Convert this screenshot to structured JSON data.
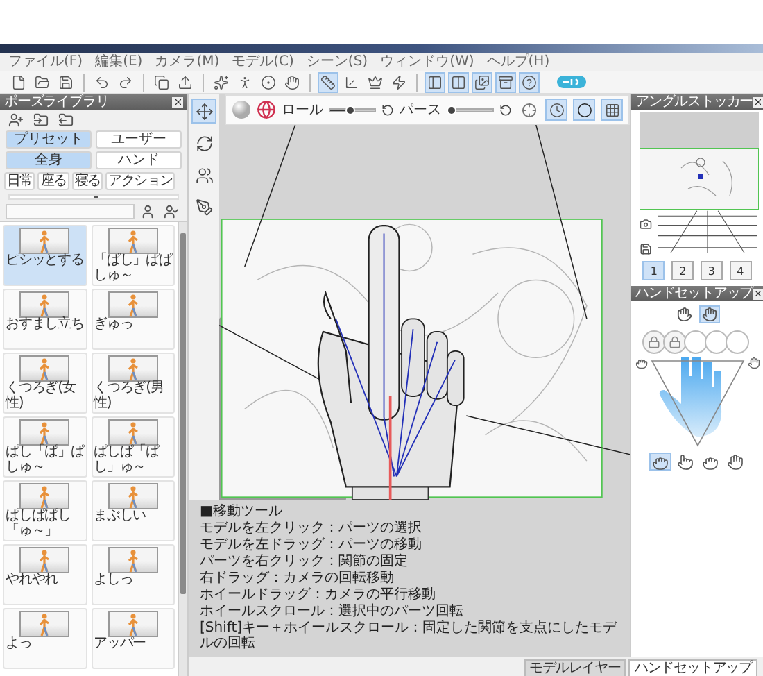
{
  "menu": [
    "ファイル(F)",
    "編集(E)",
    "カメラ(M)",
    "モデル(C)",
    "シーン(S)",
    "ウィンドウ(W)",
    "ヘルプ(H)"
  ],
  "toolbar": {
    "groups": [
      [
        {
          "kind": "new",
          "selected": false
        },
        {
          "kind": "open",
          "selected": false
        },
        {
          "kind": "save",
          "selected": false
        }
      ],
      [
        {
          "kind": "undo",
          "selected": false
        },
        {
          "kind": "redo",
          "selected": false
        }
      ],
      [
        {
          "kind": "copy",
          "selected": false
        },
        {
          "kind": "export",
          "selected": false
        }
      ],
      [
        {
          "kind": "sparkle",
          "selected": false
        },
        {
          "kind": "figure",
          "selected": false
        },
        {
          "kind": "target",
          "selected": false
        },
        {
          "kind": "hand",
          "selected": false
        }
      ],
      [
        {
          "kind": "ruler",
          "selected": true
        },
        {
          "kind": "axes",
          "selected": false
        },
        {
          "kind": "crown",
          "selected": false
        },
        {
          "kind": "bolt",
          "selected": false
        }
      ],
      [
        {
          "kind": "panel",
          "selected": true
        },
        {
          "kind": "columns",
          "selected": true
        },
        {
          "kind": "images",
          "selected": true
        },
        {
          "kind": "archive",
          "selected": true
        },
        {
          "kind": "help",
          "selected": true
        }
      ]
    ]
  },
  "pose_library": {
    "title": "ポーズライブラリ",
    "source_tabs": [
      {
        "label": "プリセット",
        "selected": true
      },
      {
        "label": "ユーザー",
        "selected": false
      }
    ],
    "body_tabs": [
      {
        "label": "全身",
        "selected": true
      },
      {
        "label": "ハンド",
        "selected": false
      }
    ],
    "categories": [
      "日常",
      "座る",
      "寝る",
      "アクション"
    ],
    "size_slider": {
      "level": 0.5
    },
    "poses": [
      {
        "label": "ピシッとする",
        "selected": true
      },
      {
        "label": "「ぱし」ぱぱしゅ～",
        "selected": false
      },
      {
        "label": "おすまし立ち",
        "selected": false
      },
      {
        "label": "ぎゅっ",
        "selected": false
      },
      {
        "label": "くつろぎ(女性)",
        "selected": false
      },
      {
        "label": "くつろぎ(男性)",
        "selected": false
      },
      {
        "label": "ぱし「ぱ」ぱしゅ～",
        "selected": false
      },
      {
        "label": "ぱしぱ「ぱし」ゅ～",
        "selected": false
      },
      {
        "label": "ぱしぱぱし「ゅ～」",
        "selected": false
      },
      {
        "label": "まぶしい",
        "selected": false
      },
      {
        "label": "やれやれ",
        "selected": false
      },
      {
        "label": "よしっ",
        "selected": false
      },
      {
        "label": "よっ",
        "selected": false
      },
      {
        "label": "アッパー",
        "selected": false
      }
    ]
  },
  "tools": [
    {
      "kind": "move",
      "selected": true
    },
    {
      "kind": "rotate",
      "selected": false
    },
    {
      "kind": "group",
      "selected": false
    },
    {
      "kind": "pen",
      "selected": false
    }
  ],
  "view_toolbar": {
    "roll": {
      "label": "ロール",
      "level": 0.45
    },
    "perspective": {
      "label": "パース",
      "level": 0.05
    },
    "modes": [
      {
        "kind": "target",
        "selected": false
      },
      {
        "kind": "clock",
        "selected": true
      },
      {
        "kind": "shade",
        "selected": true
      },
      {
        "kind": "texture",
        "selected": true
      }
    ]
  },
  "help": {
    "title": "■移動ツール",
    "lines": [
      "モデルを左クリック：パーツの選択",
      "モデルを左ドラッグ：パーツの移動",
      "パーツを右クリック：関節の固定",
      "右ドラッグ：カメラの回転移動",
      "ホイールドラッグ：カメラの平行移動",
      "ホイールスクロール：選択中のパーツ回転",
      "[Shift]キー＋ホイールスクロール：固定した関節を支点にしたモデルの回転"
    ]
  },
  "angle_stocker": {
    "title": "アングルストッカー",
    "slots": [
      {
        "label": "1",
        "selected": true
      },
      {
        "label": "2",
        "selected": false
      },
      {
        "label": "3",
        "selected": false
      },
      {
        "label": "4",
        "selected": false
      }
    ]
  },
  "hand_setup": {
    "title": "ハンドセットアップ",
    "hands": [
      {
        "kind": "left",
        "selected": false
      },
      {
        "kind": "right",
        "selected": true
      }
    ],
    "fingers": [
      {
        "locked": true
      },
      {
        "locked": true
      },
      {
        "locked": false
      },
      {
        "locked": false
      },
      {
        "locked": false
      }
    ],
    "presets": [
      {
        "kind": "fist",
        "selected": true
      },
      {
        "kind": "point",
        "selected": false
      },
      {
        "kind": "grip",
        "selected": false
      },
      {
        "kind": "open",
        "selected": false
      }
    ]
  },
  "bottom_tabs": [
    {
      "label": "モデルレイヤー",
      "selected": true
    },
    {
      "label": "ハンドセットアップ",
      "selected": false
    }
  ]
}
